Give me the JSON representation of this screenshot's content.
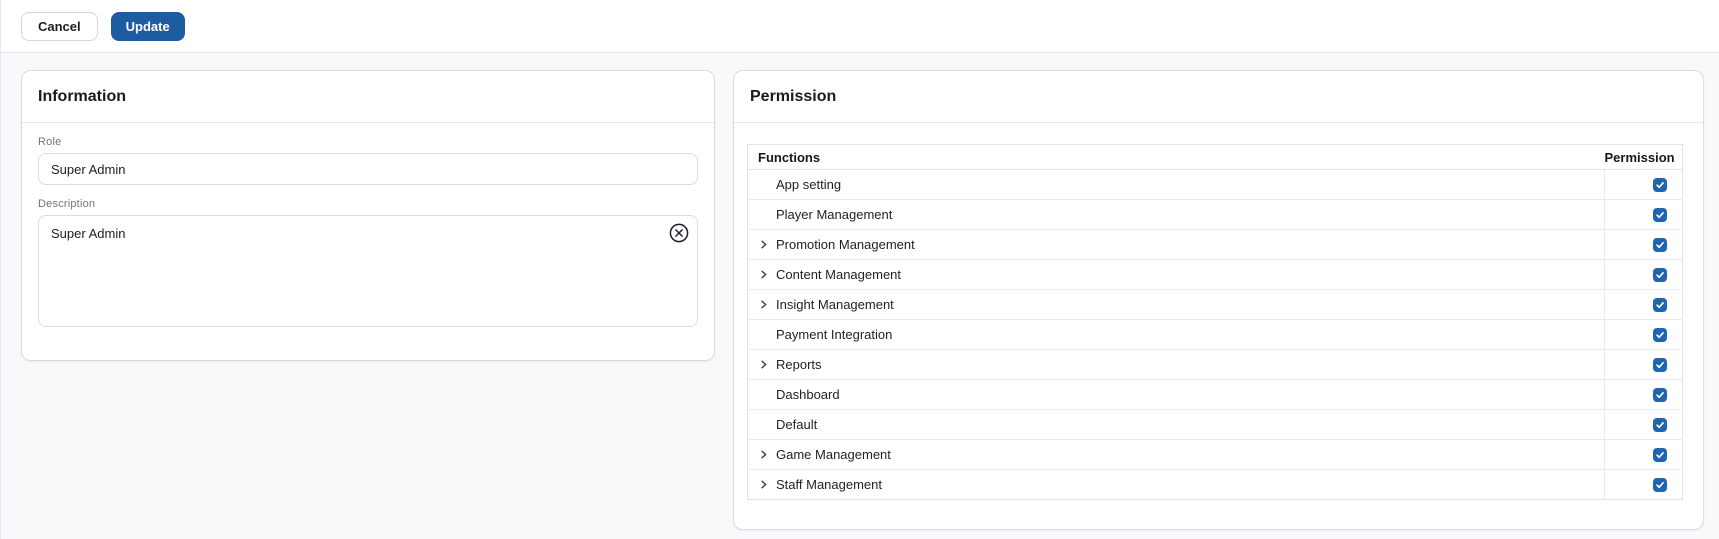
{
  "toolbar": {
    "cancel_label": "Cancel",
    "update_label": "Update"
  },
  "information_panel": {
    "title": "Information",
    "role_label": "Role",
    "role_value": "Super Admin",
    "description_label": "Description",
    "description_value": "Super Admin",
    "clear_icon": "circle-x-icon"
  },
  "permission_panel": {
    "title": "Permission",
    "table": {
      "columns": [
        "Functions",
        "Permission"
      ],
      "rows": [
        {
          "label": "App setting",
          "expandable": false,
          "checked": true
        },
        {
          "label": "Player Management",
          "expandable": false,
          "checked": true
        },
        {
          "label": "Promotion Management",
          "expandable": true,
          "checked": true
        },
        {
          "label": "Content Management",
          "expandable": true,
          "checked": true
        },
        {
          "label": "Insight Management",
          "expandable": true,
          "checked": true
        },
        {
          "label": "Payment Integration",
          "expandable": false,
          "checked": true
        },
        {
          "label": "Reports",
          "expandable": true,
          "checked": true
        },
        {
          "label": "Dashboard",
          "expandable": false,
          "checked": true
        },
        {
          "label": "Default",
          "expandable": false,
          "checked": true
        },
        {
          "label": "Game Management",
          "expandable": true,
          "checked": true
        },
        {
          "label": "Staff Management",
          "expandable": true,
          "checked": true
        }
      ]
    }
  },
  "colors": {
    "primary_blue": "#1e5ca1",
    "checkbox_blue": "#2065b0",
    "content_background": "#f8f9fb"
  }
}
